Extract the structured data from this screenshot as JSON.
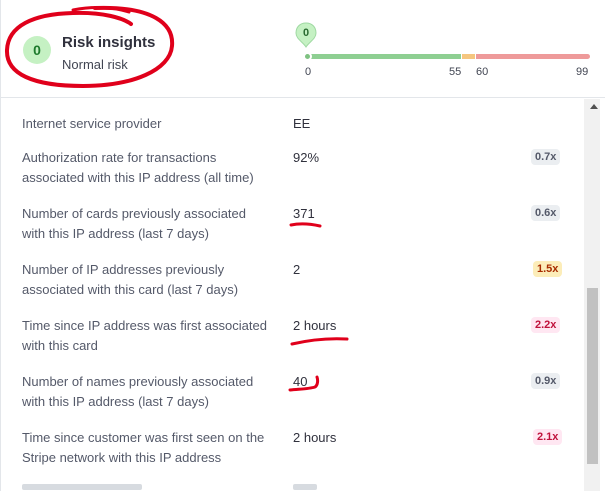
{
  "header": {
    "score": "0",
    "title": "Risk insights",
    "subtitle": "Normal risk"
  },
  "risk_scale": {
    "current_score": "0",
    "ticks": [
      "0",
      "55",
      "60",
      "99"
    ],
    "colors": {
      "normal": "#8ecf92",
      "elevated": "#f5c67f",
      "highest": "#ee9a9a"
    }
  },
  "rows": [
    {
      "label": "Internet service provider",
      "value": "EE",
      "badge": "",
      "badge_tone": ""
    },
    {
      "label": "Authorization rate for transactions associated with this IP address (all time)",
      "value": "92%",
      "badge": "0.7x",
      "badge_tone": "grey"
    },
    {
      "label": "Number of cards previously associated with this IP address (last 7 days)",
      "value": "371",
      "badge": "0.6x",
      "badge_tone": "grey"
    },
    {
      "label": "Number of IP addresses previously associated with this card (last 7 days)",
      "value": "2",
      "badge": "1.5x",
      "badge_tone": "amber"
    },
    {
      "label": "Time since IP address was first associated with this card",
      "value": "2 hours",
      "badge": "2.2x",
      "badge_tone": "red"
    },
    {
      "label": "Number of names previously associated with this IP address (last 7 days)",
      "value": "40",
      "badge": "0.9x",
      "badge_tone": "grey"
    },
    {
      "label": "Time since customer was first seen on the Stripe network with this IP address",
      "value": "2 hours",
      "badge": "2.1x",
      "badge_tone": "red"
    }
  ],
  "annotation_color": "#e0001b"
}
